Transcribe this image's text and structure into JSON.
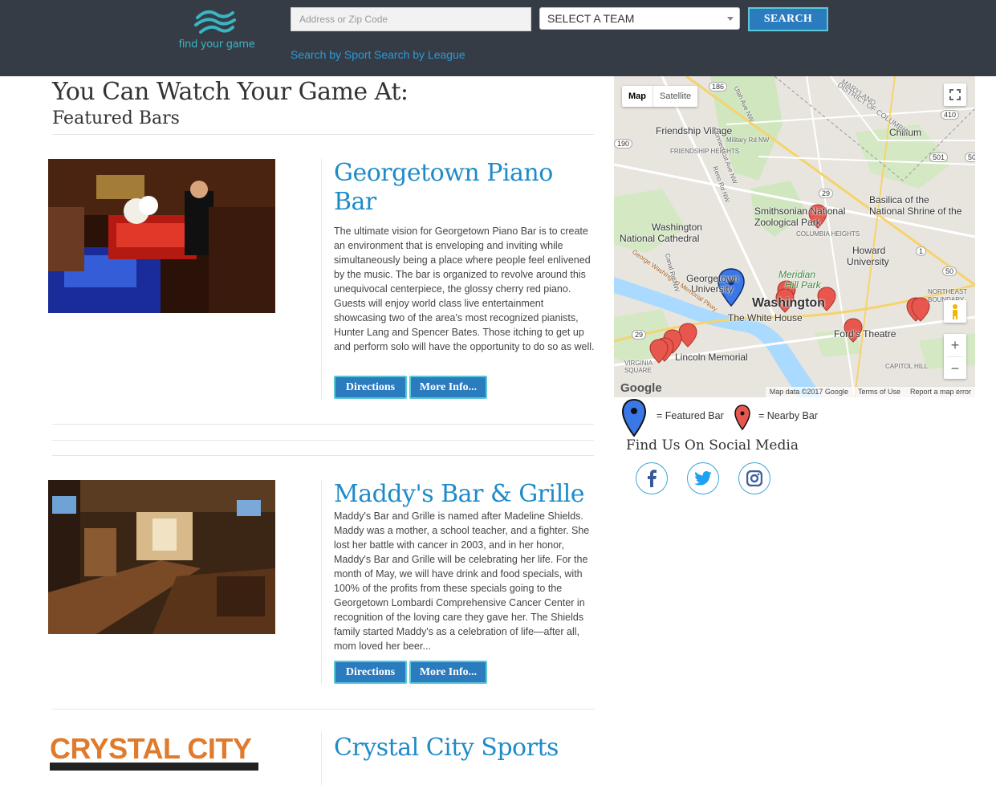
{
  "header": {
    "logo_text": "find your game",
    "search_placeholder": "Address or Zip Code",
    "team_select_value": "SELECT A TEAM",
    "search_button": "SEARCH",
    "nav_links": [
      "Search by Sport",
      "Search by League"
    ]
  },
  "main": {
    "page_title": "You Can Watch Your Game At:",
    "section_title": "Featured Bars",
    "bars": [
      {
        "name": "Georgetown Piano Bar",
        "description": "The ultimate vision for Georgetown Piano Bar is to create an environment that is enveloping and inviting while simultaneously being a place where people feel enlivened by the music. The bar is organized to revolve around this unequivocal centerpiece, the glossy cherry red piano. Guests will enjoy world class live entertainment showcasing two of the area's most recognized pianists, Hunter Lang and Spencer Bates. Those itching to get up and perform solo will have the opportunity to do so as well.",
        "directions_label": "Directions",
        "more_info_label": "More Info..."
      },
      {
        "name": "Maddy's Bar & Grille",
        "description": "Maddy's Bar and Grille is named after Madeline Shields. Maddy was a mother, a school teacher, and a fighter. She lost her battle with cancer in 2003, and in her honor, Maddy's Bar and Grille will be celebrating her life. For the month of May, we will have drink and food specials, with 100% of the profits from these specials going to the Georgetown Lombardi Comprehensive Cancer Center in recognition of the loving care they gave her. The Shields family started Maddy's as a celebration of life—after all, mom loved her beer...",
        "directions_label": "Directions",
        "more_info_label": "More Info..."
      },
      {
        "name": "Crystal City Sports",
        "logo_text": "CRYSTAL CITY"
      }
    ]
  },
  "map": {
    "tabs": [
      "Map",
      "Satellite"
    ],
    "labels": [
      "Friendship Village",
      "FRIENDSHIP HEIGHTS",
      "Chillum",
      "Basilica of the",
      "National Shrine of the",
      "Smithsonian National",
      "Zoological Park",
      "COLUMBIA HEIGHTS",
      "Washington",
      "National Cathedral",
      "Meridian",
      "Hill Park",
      "Howard",
      "University",
      "Georgetown",
      "University",
      "Washington",
      "The White House",
      "Ford's Theatre",
      "Lincoln Memorial",
      "NORTHEAST",
      "BOUNDARY",
      "CAPITOL HILL",
      "VIRGINIA SQUARE",
      "George Washington Memorial Pkwy",
      "Military Rd NW",
      "Utah Ave NW",
      "Connecticut Ave NW",
      "Reno Rd NW",
      "Canal Rd NW",
      "MARYLAND",
      "DISTRICT OF COLUMBIA"
    ],
    "route_numbers": [
      "186",
      "410",
      "501",
      "50",
      "190",
      "29",
      "29",
      "1",
      "50"
    ],
    "google_text": "Google",
    "footer": [
      "Map data ©2017 Google",
      "Terms of Use",
      "Report a map error"
    ],
    "zoom_in": "+",
    "zoom_out": "−"
  },
  "legend": {
    "featured": "= Featured Bar",
    "nearby": "= Nearby Bar"
  },
  "social": {
    "title": "Find Us On Social Media",
    "icons": [
      "facebook-icon",
      "twitter-icon",
      "instagram-icon"
    ]
  },
  "colors": {
    "header_bg": "#363c46",
    "accent_blue": "#1e8bc9",
    "button_blue": "#2b7bbf",
    "button_border": "#5bc8d8",
    "nearby_marker": "#e8574d",
    "featured_marker": "#3b78e7"
  }
}
